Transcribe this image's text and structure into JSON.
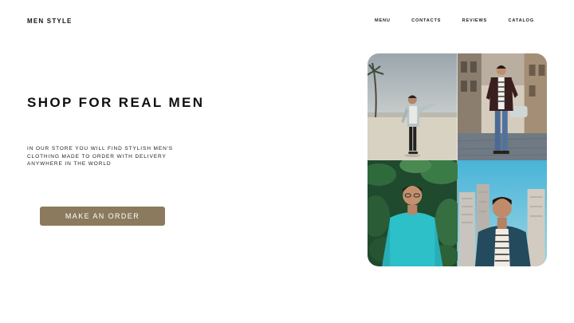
{
  "brand": "MEN STYLE",
  "nav": {
    "items": [
      {
        "label": "MENU",
        "name": "nav-menu"
      },
      {
        "label": "CONTACTS",
        "name": "nav-contacts"
      },
      {
        "label": "REVIEWS",
        "name": "nav-reviews"
      },
      {
        "label": "CATALOG",
        "name": "nav-catalog"
      }
    ]
  },
  "hero": {
    "title": "SHOP FOR REAL MEN",
    "description": "IN OUR STORE YOU WILL FIND STYLISH MEN'S CLOTHING MADE TO ORDER WITH DELIVERY ANYWHERE IN THE WORLD",
    "cta_label": "MAKE AN ORDER"
  },
  "colors": {
    "accent": "#8c7a5e",
    "text": "#111111",
    "background": "#ffffff"
  },
  "gallery": {
    "photos": [
      {
        "name": "photo-man-beach-skateboard"
      },
      {
        "name": "photo-man-street-walking"
      },
      {
        "name": "photo-man-teal-shirt-plants"
      },
      {
        "name": "photo-man-striped-shirt-city"
      }
    ]
  }
}
